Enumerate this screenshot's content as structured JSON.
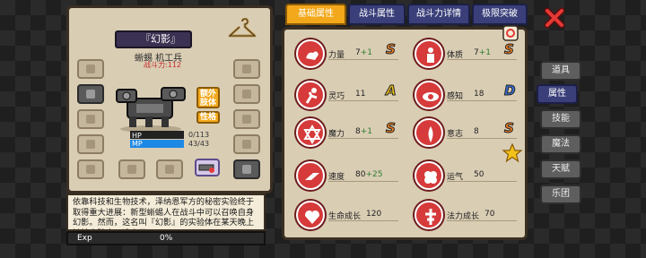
{
  "character": {
    "name": "『幻影』",
    "class_icon": "✕",
    "subtitle": "蜥蜴 机工兵",
    "power": "战斗力:112",
    "hp_label": "HP",
    "hp_value": "0/113",
    "mp_label": "MP",
    "mp_value": "43/43",
    "hp_fraction": 0,
    "mp_fraction": 1,
    "extra_body_label": "额外\n肢体",
    "personality_label": "性格",
    "description": "依靠科技和生物技术，泽纳恩军方的秘密实验终于取得重大进展：新型蜥蜴人在战斗中可以召唤自身幻影。然而，这名叫『幻影』的实验体在某天晚上被扶实验室，逃走了……",
    "exp_label": "Exp",
    "exp_value": "0%"
  },
  "tabs": [
    {
      "label": "基础属性"
    },
    {
      "label": "战斗属性"
    },
    {
      "label": "战斗力详情"
    },
    {
      "label": "极限突破"
    }
  ],
  "stats": [
    {
      "label": "力量",
      "value": "7",
      "bonus": "+1",
      "grade": "S",
      "grade_color": "#f5811f",
      "icon": "muscle-icon"
    },
    {
      "label": "体质",
      "value": "7",
      "bonus": "+1",
      "grade": "S",
      "grade_color": "#f5811f",
      "icon": "body-icon"
    },
    {
      "label": "灵巧",
      "value": "11",
      "bonus": "",
      "grade": "A",
      "grade_color": "#f2c21a",
      "icon": "running-icon"
    },
    {
      "label": "感知",
      "value": "18",
      "bonus": "",
      "grade": "D",
      "grade_color": "#3b6fd6",
      "icon": "eye-icon"
    },
    {
      "label": "魔力",
      "value": "8",
      "bonus": "+1",
      "grade": "S",
      "grade_color": "#f5811f",
      "icon": "hexagram-icon"
    },
    {
      "label": "意志",
      "value": "8",
      "bonus": "",
      "grade": "S",
      "grade_color": "#f5811f",
      "icon": "will-icon"
    },
    {
      "label": "速度",
      "value": "80",
      "bonus": "+25",
      "grade": "",
      "grade_color": "",
      "icon": "speed-icon"
    },
    {
      "label": "运气",
      "value": "50",
      "bonus": "",
      "grade": "",
      "grade_color": "",
      "icon": "clover-icon"
    },
    {
      "label": "生命成长",
      "value": "120",
      "bonus": "",
      "grade": "",
      "grade_color": "",
      "icon": "life-growth-icon"
    },
    {
      "label": "法力成长",
      "value": "70",
      "bonus": "",
      "grade": "",
      "grade_color": "",
      "icon": "mana-growth-icon"
    }
  ],
  "side_tabs": [
    {
      "label": "道具"
    },
    {
      "label": "属性"
    },
    {
      "label": "技能"
    },
    {
      "label": "魔法"
    },
    {
      "label": "天赋"
    },
    {
      "label": "乐团"
    }
  ],
  "colors": {
    "accent_orange": "#f2a81a",
    "tab_blue": "#3a3f7a",
    "stat_red": "#d63a3a",
    "close_red": "#e53935"
  }
}
